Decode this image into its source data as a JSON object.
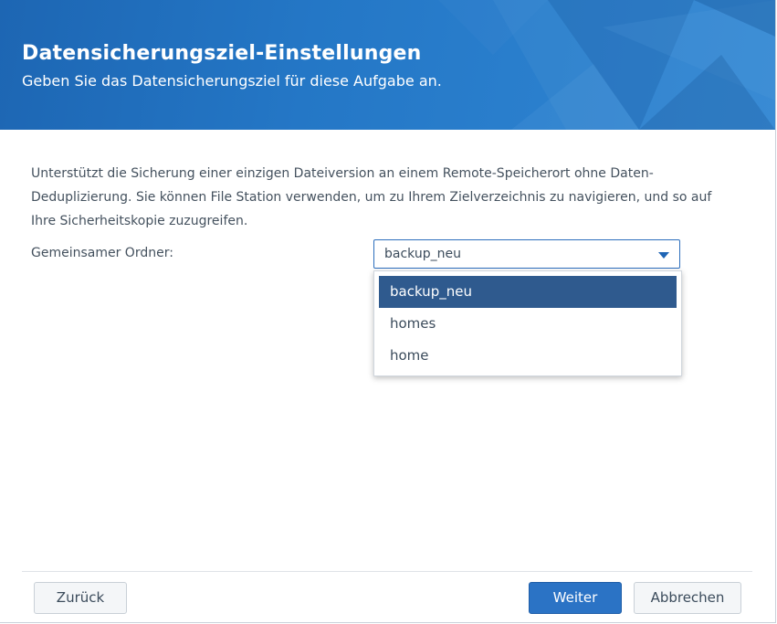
{
  "header": {
    "title": "Datensicherungsziel-Einstellungen",
    "subtitle": "Geben Sie das Datensicherungsziel für diese Aufgabe an."
  },
  "description": "Unterstützt die Sicherung einer einzigen Dateiversion an einem Remote-Speicherort ohne Daten-Deduplizierung. Sie können File Station verwenden, um zu Ihrem Zielverzeichnis zu navigieren, und so auf Ihre Sicherheitskopie zuzugreifen.",
  "field": {
    "label": "Gemeinsamer Ordner:",
    "value": "backup_neu",
    "options": [
      "backup_neu",
      "homes",
      "home"
    ],
    "selected_index": 0
  },
  "footer": {
    "back_label": "Zurück",
    "next_label": "Weiter",
    "cancel_label": "Abbrechen"
  },
  "colors": {
    "header_blue": "#2477c6",
    "accent": "#2b73c5",
    "selected_item": "#2f5a8e"
  }
}
